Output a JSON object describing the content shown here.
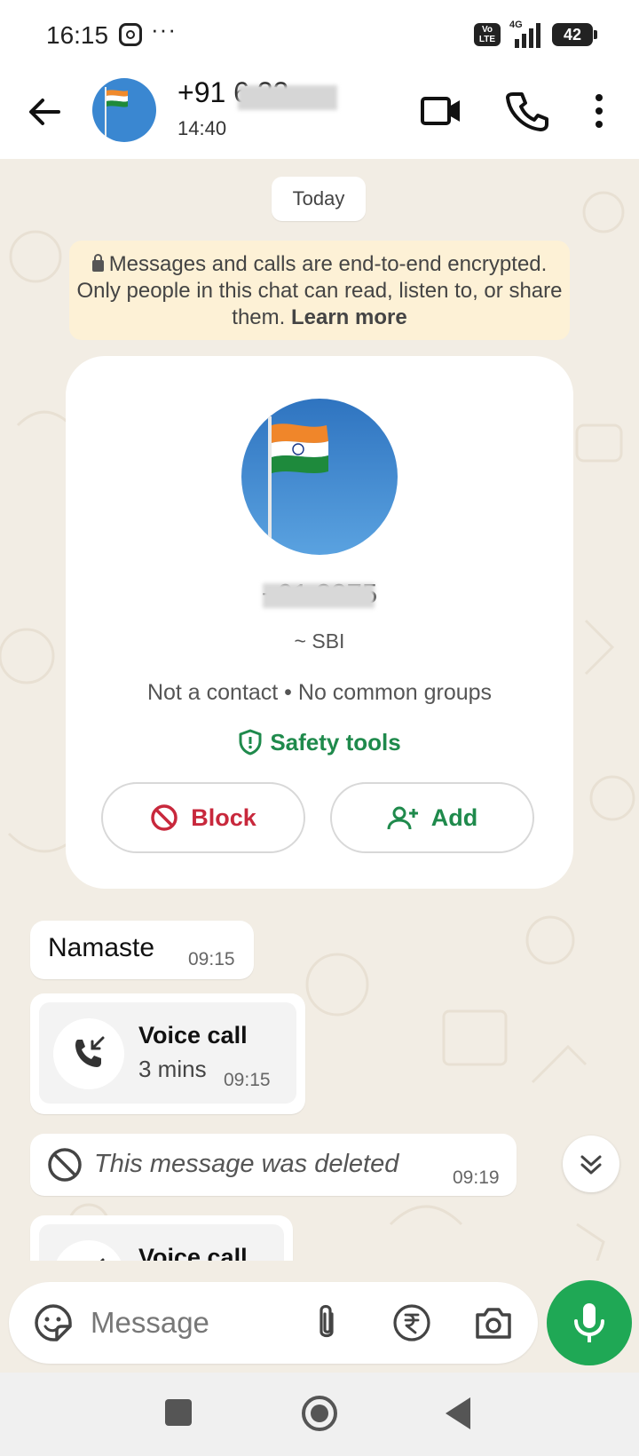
{
  "status_bar": {
    "time": "16:15",
    "overflow": "···",
    "volte": "Vo LTE",
    "network": "4G",
    "battery": "42"
  },
  "header": {
    "contact_name": "+91 6       33…",
    "last_seen": "14:40"
  },
  "chat": {
    "date_chip": "Today",
    "encryption_notice": "Messages and calls are end-to-end encrypted. Only people in this chat can read, listen to, or share them.",
    "learn_more": "Learn more",
    "profile_card": {
      "number": "+91           3375",
      "alias": "~ SBI",
      "info": "Not a contact • No common groups",
      "safety_tools": "Safety tools",
      "block_label": "Block",
      "add_label": "Add"
    },
    "messages": [
      {
        "text": "Namaste",
        "time": "09:15"
      },
      {
        "title": "Voice call",
        "duration": "3 mins",
        "time": "09:15"
      },
      {
        "text": "This message was deleted",
        "time": "09:19"
      },
      {
        "title": "Voice call"
      }
    ]
  },
  "input": {
    "placeholder": "Message"
  },
  "colors": {
    "brand_green": "#1fa855",
    "block_red": "#c8283c",
    "chat_background": "#f2ede4"
  }
}
